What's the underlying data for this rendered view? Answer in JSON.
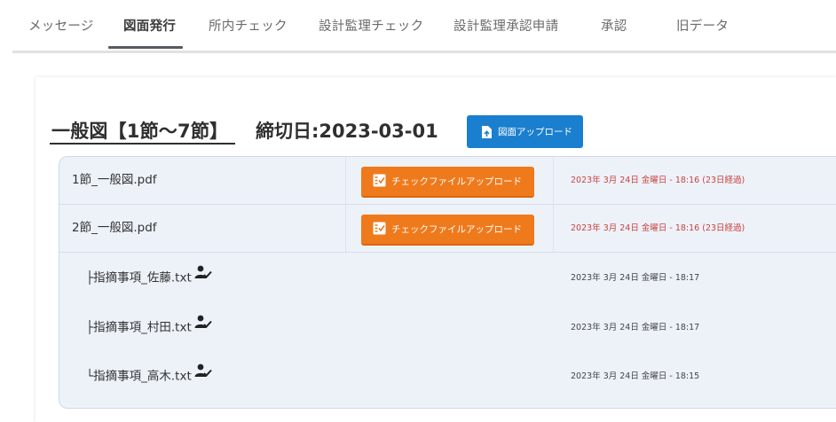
{
  "tabs": [
    {
      "label": "メッセージ",
      "active": false
    },
    {
      "label": "図面発行",
      "active": true
    },
    {
      "label": "所内チェック",
      "active": false
    },
    {
      "label": "設計監理チェック",
      "active": false
    },
    {
      "label": "設計監理承認申請",
      "active": false
    },
    {
      "label": "承認",
      "active": false
    },
    {
      "label": "旧データ",
      "active": false
    }
  ],
  "section": {
    "title": "一般図【1節〜7節】",
    "deadline": "締切日:2023-03-01",
    "upload_label": "図面アップロード",
    "upload_icon": "upload-file-icon"
  },
  "files": [
    {
      "name": "1節_一般図.pdf",
      "button": "チェックファイルアップロード",
      "button_icon": "checklist-icon",
      "date": "2023年 3月 24日 金曜日 - 18:16 (23日経過)",
      "overdue": true
    },
    {
      "name": "2節_一般図.pdf",
      "button": "チェックファイルアップロード",
      "button_icon": "checklist-icon",
      "date": "2023年 3月 24日 金曜日 - 18:16 (23日経過)",
      "overdue": true
    },
    {
      "name": "├指摘事項_佐藤.txt",
      "icon": "user-check-icon",
      "date": "2023年 3月 24日 金曜日 - 18:17",
      "overdue": false
    },
    {
      "name": "├指摘事項_村田.txt",
      "icon": "user-check-icon",
      "date": "2023年 3月 24日 金曜日 - 18:17",
      "overdue": false
    },
    {
      "name": "└指摘事項_高木.txt",
      "icon": "user-check-icon",
      "date": "2023年 3月 24日 金曜日 - 18:15",
      "overdue": false
    }
  ],
  "colors": {
    "accent_blue": "#1a7fce",
    "accent_orange": "#ef7a1c",
    "overdue_red": "#c9433f",
    "table_bg": "#edf2f9"
  }
}
